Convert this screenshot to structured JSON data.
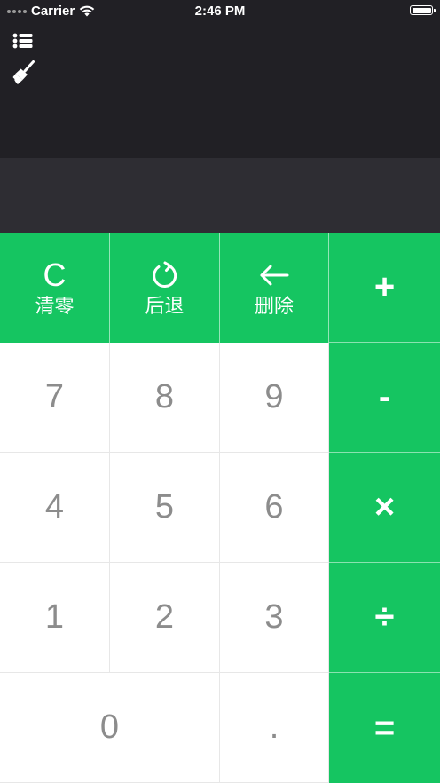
{
  "status_bar": {
    "carrier": "Carrier",
    "time": "2:46 PM"
  },
  "toolbar": {
    "history_icon": "list-icon",
    "clear_icon": "broom-icon"
  },
  "colors": {
    "accent": "#15c561",
    "header_bg": "#212025",
    "display_bg": "#2e2d33",
    "digit_text": "#8c8c8c"
  },
  "function_keys": [
    {
      "glyph": "C",
      "label": "清零",
      "icon": "clear-c"
    },
    {
      "glyph": "",
      "label": "后退",
      "icon": "undo-icon"
    },
    {
      "glyph": "",
      "label": "删除",
      "icon": "left-arrow-icon"
    }
  ],
  "digit_keys": [
    "7",
    "8",
    "9",
    "4",
    "5",
    "6",
    "1",
    "2",
    "3",
    "0",
    "."
  ],
  "operator_keys": [
    "+",
    "-",
    "×",
    "÷",
    "="
  ]
}
